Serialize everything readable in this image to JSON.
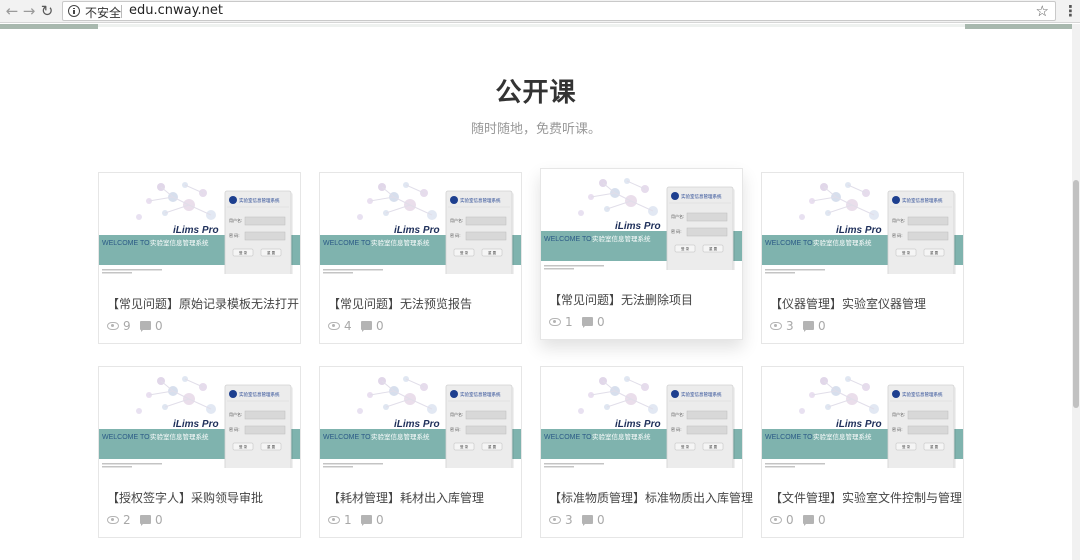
{
  "browser": {
    "security_label": "不安全",
    "url": "edu.cnway.net"
  },
  "section": {
    "title": "公开课",
    "subtitle": "随时随地，免费听课。"
  },
  "thumbnail": {
    "brand": "iLims Pro",
    "welcome": "WELCOME TO",
    "system_name": "实验室信息管理系统",
    "login_title": "实验室信息管理系统",
    "username_label": "用户名:",
    "password_label": "密  码:",
    "login_button": "登 录",
    "reset_button": "重 置",
    "accent_color": "#7fb3ae",
    "logo_color": "#1d3f8f"
  },
  "courses": [
    {
      "title": "【常见问题】原始记录模板无法打开",
      "views": "9",
      "comments": "0"
    },
    {
      "title": "【常见问题】无法预览报告",
      "views": "4",
      "comments": "0"
    },
    {
      "title": "【常见问题】无法删除项目",
      "views": "1",
      "comments": "0"
    },
    {
      "title": "【仪器管理】实验室仪器管理",
      "views": "3",
      "comments": "0"
    },
    {
      "title": "【授权签字人】采购领导审批",
      "views": "2",
      "comments": "0"
    },
    {
      "title": "【耗材管理】耗材出入库管理",
      "views": "1",
      "comments": "0"
    },
    {
      "title": "【标准物质管理】标准物质出入库管理",
      "views": "3",
      "comments": "0"
    },
    {
      "title": "【文件管理】实验室文件控制与管理",
      "views": "0",
      "comments": "0"
    }
  ]
}
